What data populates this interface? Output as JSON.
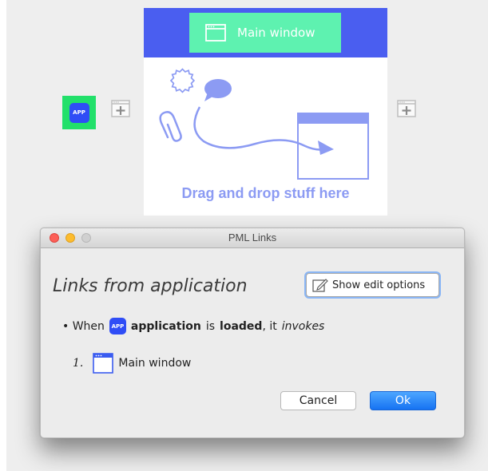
{
  "colors": {
    "app_node": "#22e06a",
    "app_badge": "#2f4df6",
    "main_header": "#4a5ef0",
    "main_tab": "#5ef2b0",
    "illustration": "#8c9bf3",
    "ok_button": "#1673f2"
  },
  "canvas": {
    "app_node": {
      "badge": "APP",
      "icon": "app-icon"
    },
    "main_window_node": {
      "title": "Main window",
      "icon": "window-icon",
      "dropzone_text": "Drag and drop stuff here",
      "illustration_icons": [
        "gear-icon",
        "speech-bubble-icon",
        "paperclip-icon",
        "arrow-icon",
        "window-icon"
      ]
    },
    "add_icons": [
      "add-window-icon",
      "add-window-icon"
    ]
  },
  "dialog": {
    "title": "PML Links",
    "heading": "Links from application",
    "edit_button": {
      "label": "Show edit options",
      "icon": "edit-icon"
    },
    "bullet": {
      "prefix": "When",
      "app_badge": "APP",
      "subject": "application",
      "verb": "is",
      "state": "loaded",
      "suffix": ", it",
      "action": "invokes"
    },
    "items": [
      {
        "num": "1.",
        "icon": "window-icon",
        "label": "Main window"
      }
    ],
    "cancel_label": "Cancel",
    "ok_label": "Ok"
  }
}
